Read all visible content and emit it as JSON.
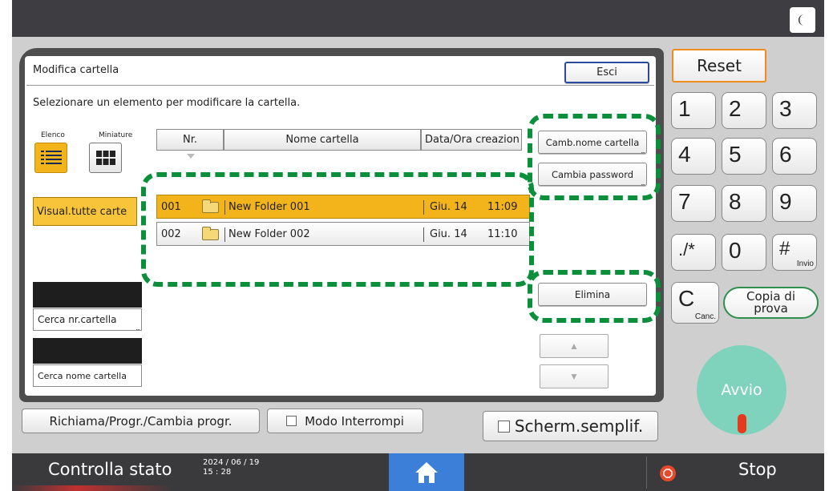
{
  "dialog": {
    "title": "Modifica cartella",
    "close_label": "Esci",
    "instruction": "Selezionare un elemento per modificare la cartella."
  },
  "view_toggle": {
    "list_label": "Elenco",
    "thumb_label": "Miniature"
  },
  "left_panel": {
    "show_all": "Visual.tutte carte",
    "search_number": "Cerca nr.cartella",
    "search_name": "Cerca nome cartella"
  },
  "table": {
    "columns": [
      "Nr.",
      "Nome cartella",
      "Data/Ora creazion"
    ],
    "rows": [
      {
        "nr": "001",
        "name": "New Folder 001",
        "date": "Giu. 14",
        "time": "11:09",
        "selected": true
      },
      {
        "nr": "002",
        "name": "New Folder 002",
        "date": "Giu. 14",
        "time": "11:10",
        "selected": false
      }
    ]
  },
  "actions": {
    "rename": "Camb.nome cartella",
    "change_password": "Cambia password",
    "delete": "Elimina"
  },
  "bottom_bar": {
    "recall": "Richiama/Progr./Cambia progr.",
    "interrupt": "Modo Interrompi",
    "simple_screen": "Scherm.semplif."
  },
  "keypad": {
    "reset": "Reset",
    "keys": [
      "1",
      "2",
      "3",
      "4",
      "5",
      "6",
      "7",
      "8",
      "9",
      "./*",
      "0",
      "#"
    ],
    "enter_sub": "Invio",
    "clear": "C",
    "clear_sub": "Canc.",
    "sample_copy": "Copia di prova",
    "start": "Avvio"
  },
  "status_bar": {
    "check_status": "Controlla stato",
    "date": "2024 / 06 / 19",
    "time": "15 : 28",
    "stop": "Stop"
  },
  "colors": {
    "selected_yellow": "#f3b41b",
    "highlight_green": "#0c8f3a",
    "reset_orange": "#f08c1e",
    "start_green": "#7fd3bc",
    "home_blue": "#3c7fd9"
  }
}
